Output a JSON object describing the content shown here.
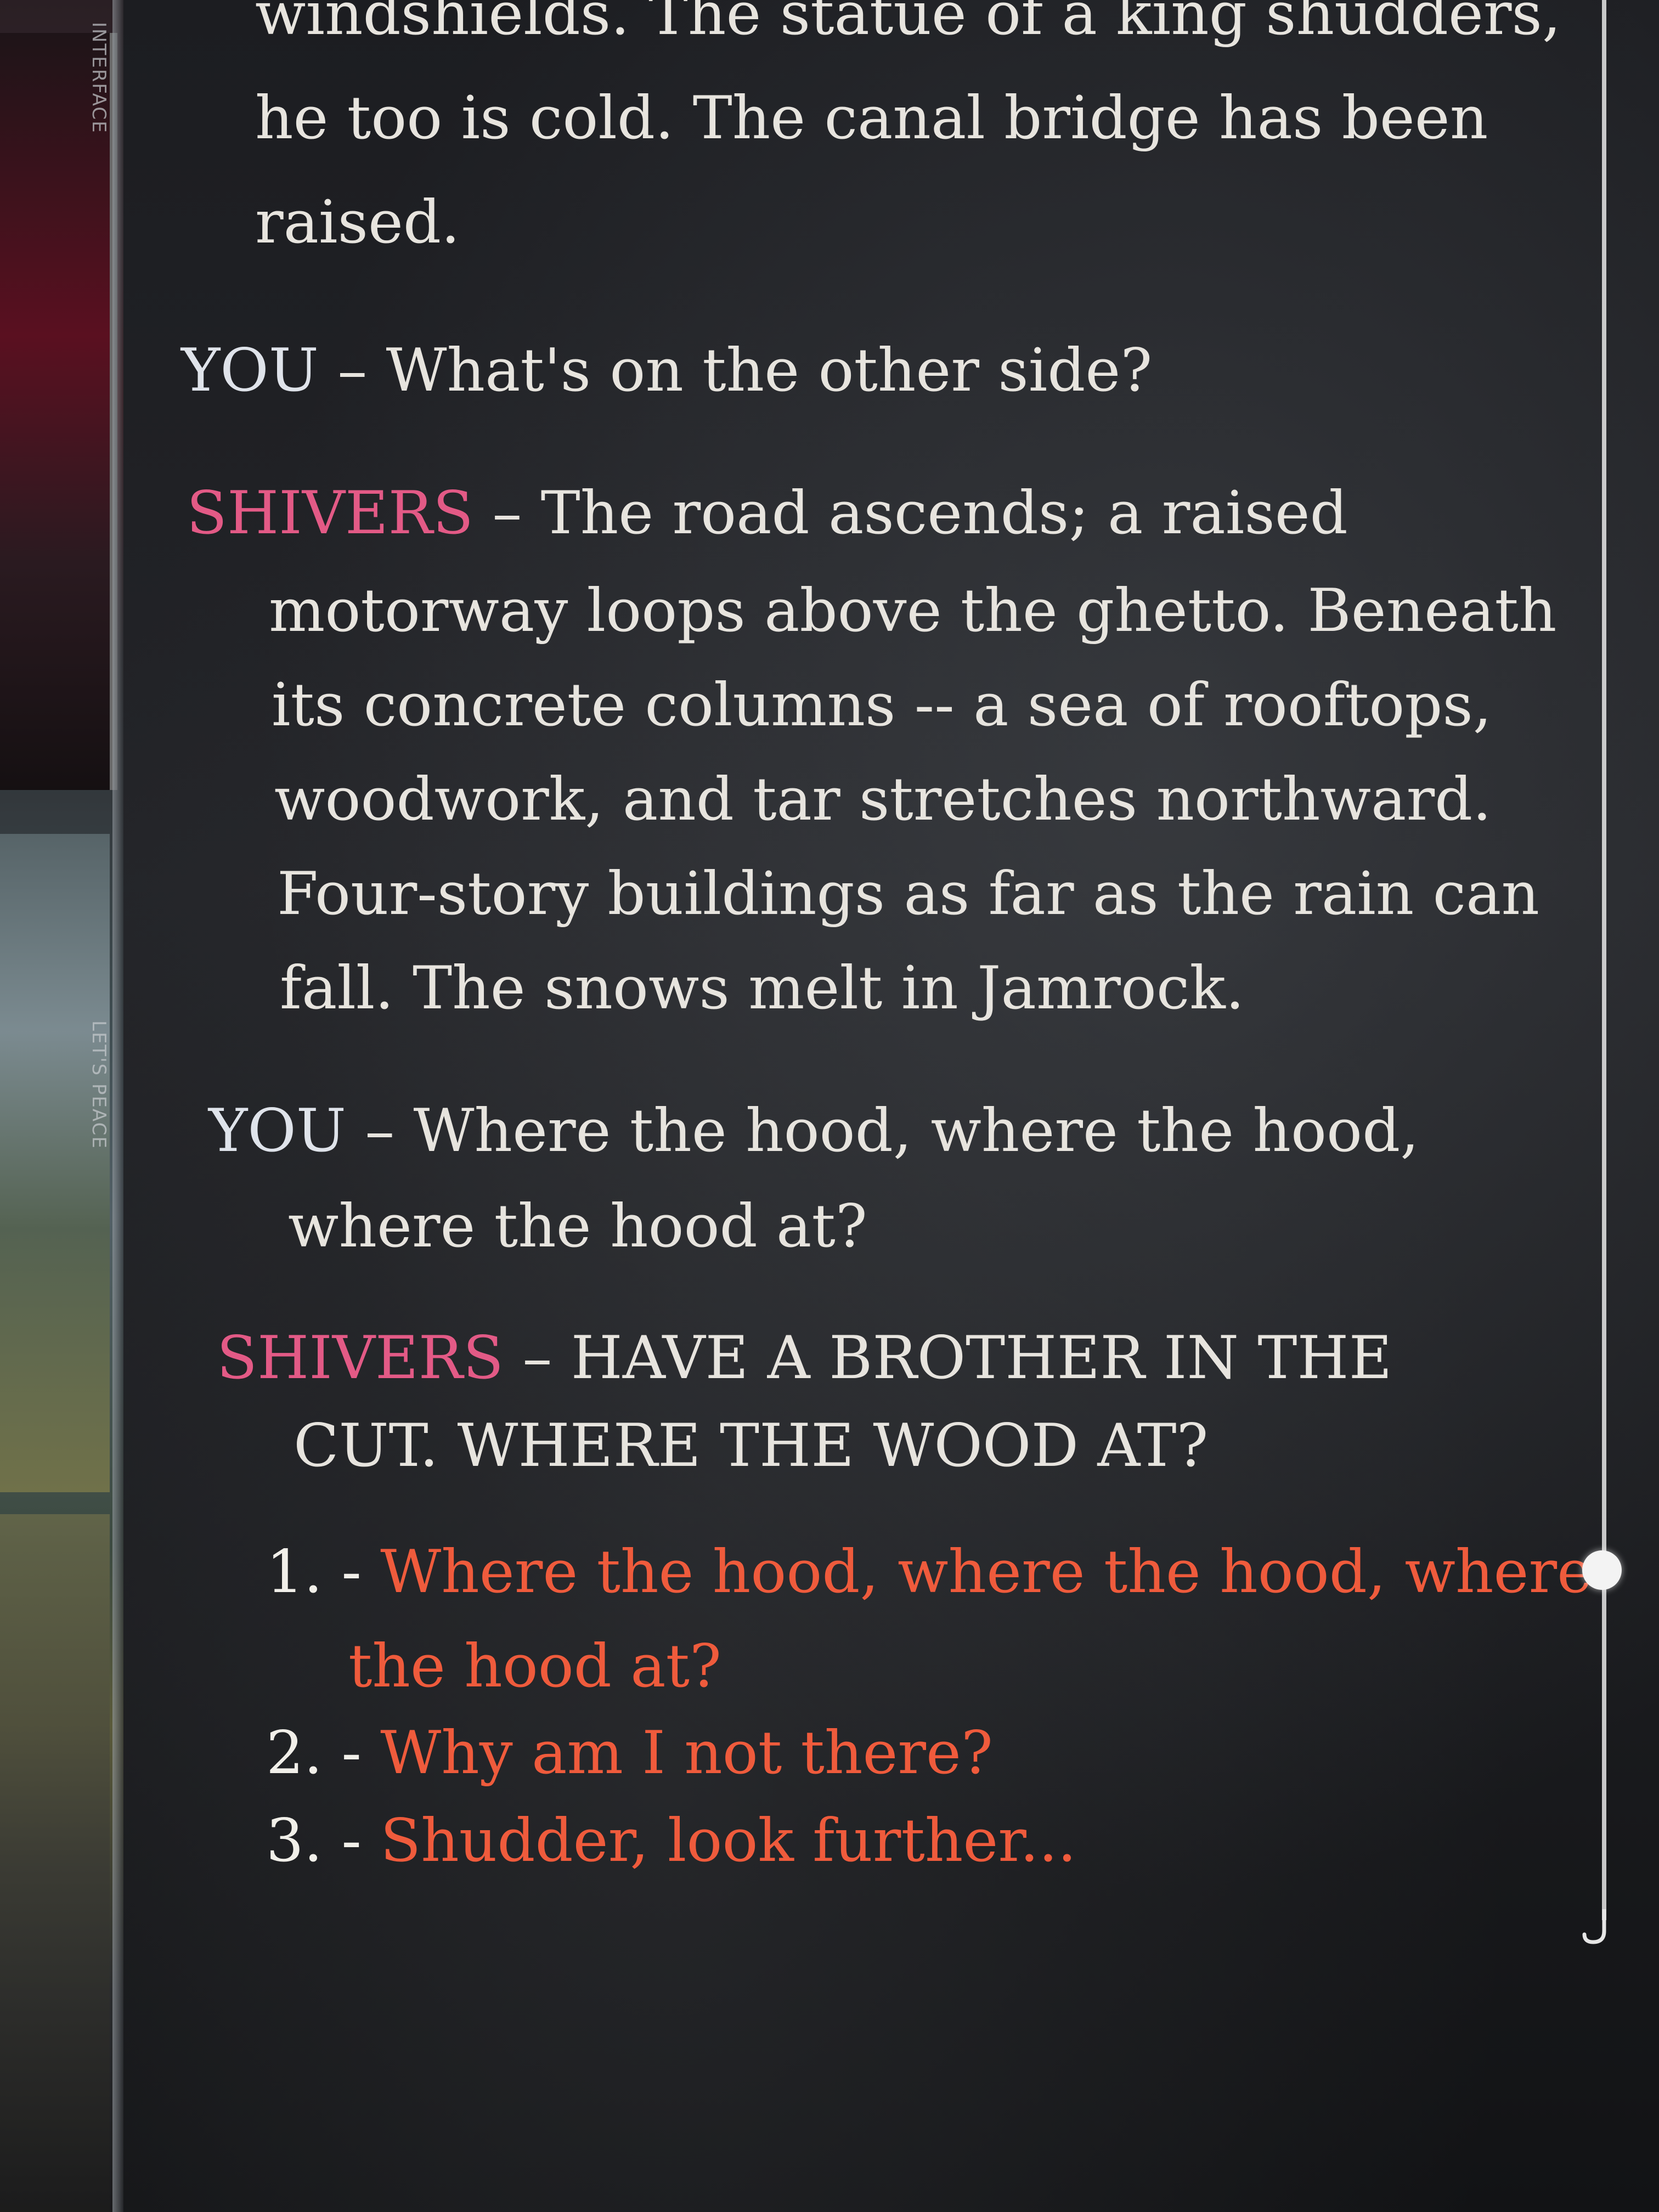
{
  "dialogue": {
    "narration_top": [
      "windshields. The statue of a king shudders,",
      "he too is cold. The canal bridge has been",
      "raised."
    ],
    "entry1": {
      "speaker": "YOU",
      "separator": "–",
      "lines": [
        "What's on the other side?"
      ]
    },
    "entry2": {
      "speaker": "SHIVERS",
      "separator": "–",
      "lines": [
        "The road ascends; a raised",
        "motorway loops above the ghetto. Beneath",
        "its concrete columns -- a sea of rooftops,",
        "woodwork, and tar stretches northward.",
        "Four-story buildings as far as the rain can",
        "fall. The snows melt in Jamrock."
      ]
    },
    "entry3": {
      "speaker": "YOU",
      "separator": "–",
      "lines": [
        "Where the hood, where the hood,",
        "where the hood at?"
      ]
    },
    "entry4": {
      "speaker": "SHIVERS",
      "separator": "–",
      "lines": [
        "HAVE A BROTHER IN THE",
        "CUT. WHERE THE WOOD AT?"
      ]
    }
  },
  "options": [
    {
      "number": "1. -",
      "lines": [
        "Where the hood, where the hood, where",
        "the hood at?"
      ]
    },
    {
      "number": "2. -",
      "lines": [
        "Why am I not there?"
      ]
    },
    {
      "number": "3. -",
      "lines": [
        "Shudder, look further..."
      ]
    }
  ],
  "edge": {
    "label_top": "INTERFACE",
    "label_mid": "LET'S PEACE"
  },
  "colors": {
    "speaker_shivers": "#e35a86",
    "option_text": "#ef5b3c",
    "body_text": "#e7e4de"
  }
}
